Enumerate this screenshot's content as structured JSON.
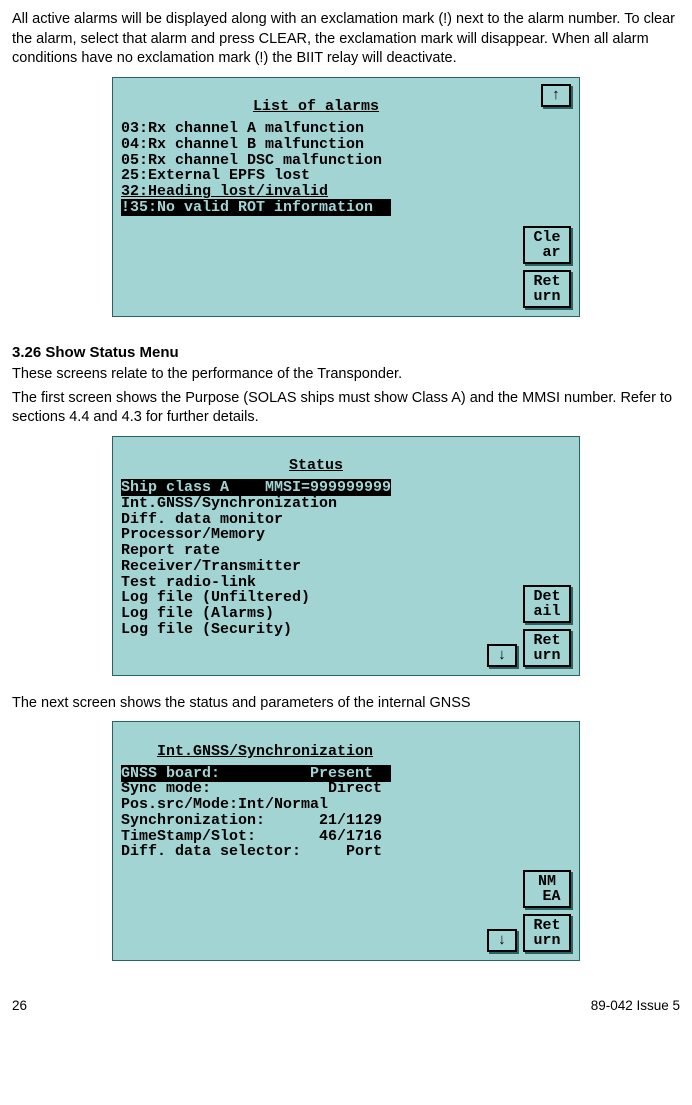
{
  "intro": {
    "p1": "All active alarms will be displayed along with an exclamation mark (!) next to the alarm number. To clear the alarm, select that alarm and press CLEAR, the exclamation mark will disappear. When all alarm conditions have no exclamation mark (!) the BIIT relay will deactivate."
  },
  "screen1": {
    "title": "List of alarms",
    "lines": {
      "l1": "03:Rx channel A malfunction",
      "l2": "04:Rx channel B malfunction",
      "l3": "05:Rx channel DSC malfunction",
      "l4": "25:External EPFS lost",
      "l5": "32:Heading lost/invalid",
      "l6": "!35:No valid ROT information  "
    },
    "btn_up": "↑",
    "btn_clear": "Cle\n ar",
    "btn_return": "Ret\nurn"
  },
  "section326": {
    "heading": "3.26    Show Status Menu",
    "p1": "These screens relate to the performance of the Transponder.",
    "p2": "The first screen shows the Purpose (SOLAS ships must show Class A) and the MMSI number. Refer to sections 4.4 and 4.3 for further details."
  },
  "screen2": {
    "title": "Status",
    "header_line": "Ship class A    MMSI=999999999",
    "lines": {
      "l1": "Int.GNSS/Synchronization",
      "l2": "Diff. data monitor",
      "l3": "Processor/Memory",
      "l4": "Report rate",
      "l5": "Receiver/Transmitter",
      "l6": "Test radio-link",
      "l7": "Log file (Unfiltered)",
      "l8": "Log file (Alarms)",
      "l9": "Log file (Security)"
    },
    "btn_detail": "Det\nail",
    "btn_down": "↓",
    "btn_return": "Ret\nurn"
  },
  "mid_p": "The next screen shows the status and parameters of the internal GNSS",
  "screen3": {
    "title": "Int.GNSS/Synchronization",
    "row1_label": "GNSS board:         ",
    "row1_value": " Present  ",
    "lines": {
      "l2": "Sync mode:             Direct",
      "l3": "Pos.src/Mode:Int/Normal",
      "l4": "Synchronization:      21/1129",
      "l5": "TimeStamp/Slot:       46/1716",
      "l6": "Diff. data selector:     Port"
    },
    "btn_nmea": "NM\n EA",
    "btn_down": "↓",
    "btn_return": "Ret\nurn"
  },
  "footer": {
    "page": "26",
    "docref": "89-042 Issue 5"
  }
}
